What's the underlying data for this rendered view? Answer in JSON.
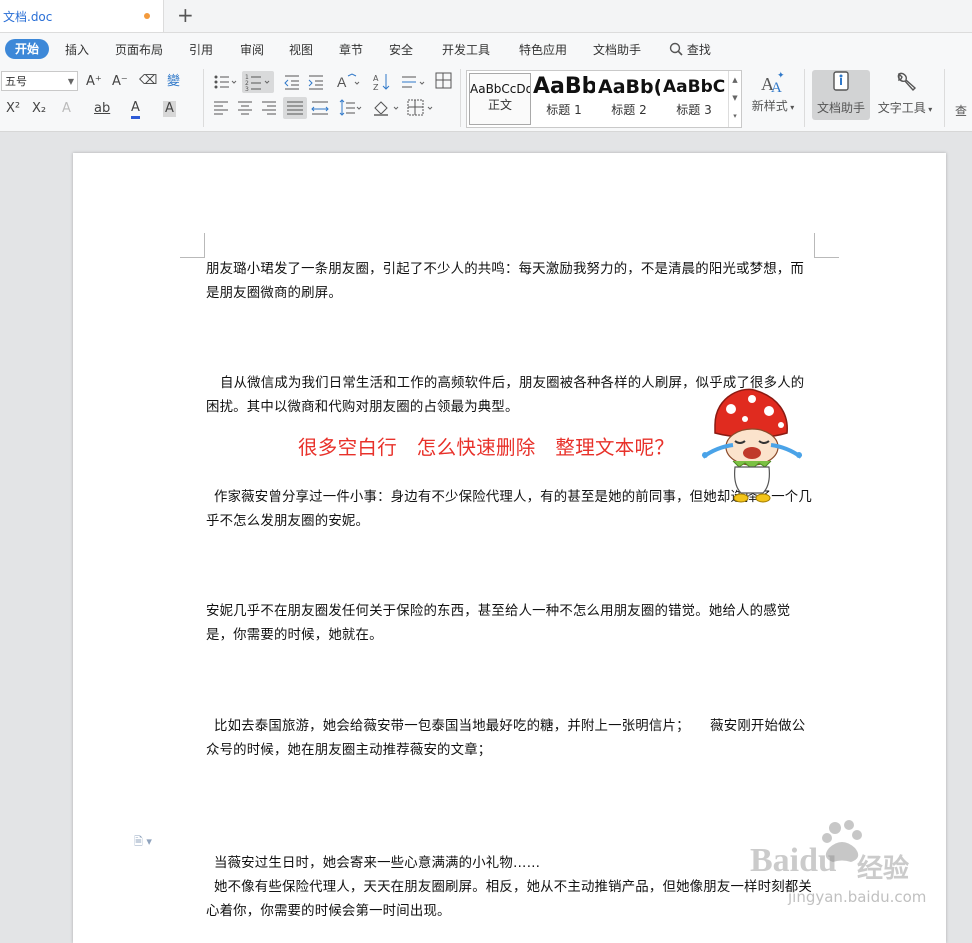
{
  "tabbar": {
    "doc_title": "文档.doc",
    "new_tab": "+"
  },
  "menubar": {
    "items": [
      "开始",
      "插入",
      "页面布局",
      "引用",
      "审阅",
      "视图",
      "章节",
      "安全",
      "开发工具",
      "特色应用",
      "文档助手"
    ],
    "search": "查找",
    "search_icon": "magnifier-icon"
  },
  "ribbon": {
    "font_size": "五号",
    "styles": [
      {
        "sample": "AaBbCcDd",
        "label": "正文"
      },
      {
        "sample": "AaBb",
        "label": "标题 1"
      },
      {
        "sample": "AaBb(",
        "label": "标题 2"
      },
      {
        "sample": "AaBbC",
        "label": "标题 3"
      }
    ],
    "new_style": "新样式",
    "doc_assistant": "文档助手",
    "text_tools": "文字工具",
    "find": "查找",
    "glyphs": {
      "font_grow": "A⁺",
      "font_shrink": "A⁻",
      "clear_format": "⌫",
      "phonetic": "變",
      "superscript": "X²",
      "subscript": "X₂",
      "text_effect": "A",
      "highlight": "ab",
      "font_color": "A",
      "char_shade": "A"
    }
  },
  "document": {
    "paragraphs": [
      "朋友璐小珺发了一条朋友圈，引起了不少人的共鸣：每天激励我努力的，不是清晨的阳光或梦想，而是朋友圈微商的刷屏。",
      "自从微信成为我们日常生活和工作的高频软件后，朋友圈被各种各样的人刷屏，似乎成了很多人的困扰。其中以微商和代购对朋友圈的占领最为典型。",
      "作家薇安曾分享过一件小事：身边有不少保险代理人，有的甚至是她的前同事，但她却选择了一个几乎不怎么发朋友圈的安妮。",
      "安妮几乎不在朋友圈发任何关于保险的东西，甚至给人一种不怎么用朋友圈的错觉。她给人的感觉是，你需要的时候，她就在。",
      "比如去泰国旅游，她会给薇安带一包泰国当地最好吃的糖，并附上一张明信片；　　薇安刚开始做公众号的时候，她在朋友圈主动推荐薇安的文章；",
      "当薇安过生日时，她会寄来一些心意满满的小礼物……",
      "她不像有些保险代理人，天天在朋友圈刷屏。相反，她从不主动推销产品，但她像朋友一样时刻都关心着你，你需要的时候会第一时间出现。"
    ],
    "banner": "很多空白行　怎么快速删除　整理文本呢？"
  },
  "watermark": {
    "brand": "Baidu",
    "brand_cn": "经验",
    "url": "jingyan.baidu.com"
  },
  "colors": {
    "accent": "#3d88d8",
    "banner": "#e8312a",
    "mushroom": "#e02b1f",
    "paper": "#ffffff"
  }
}
